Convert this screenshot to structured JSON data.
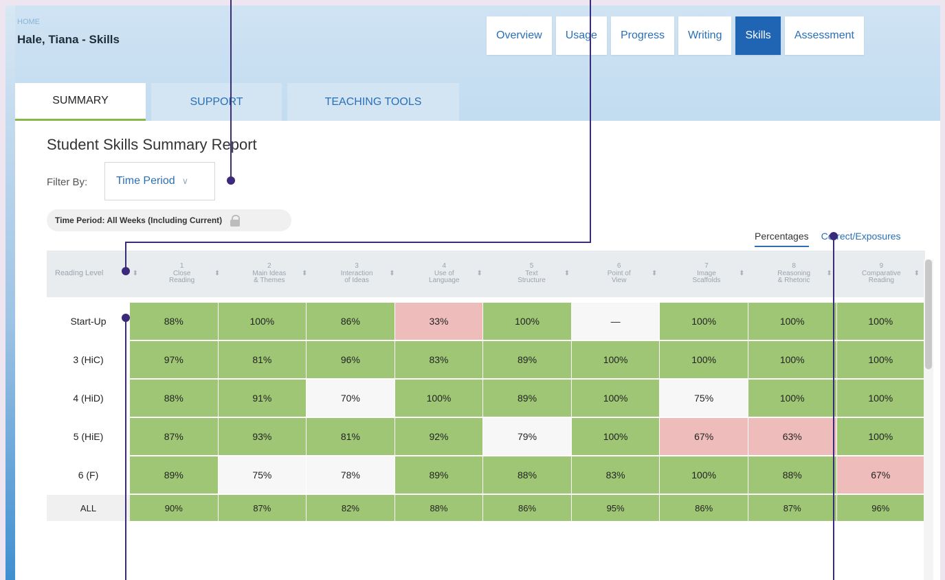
{
  "breadcrumb": "HOME",
  "page_title": "Hale, Tiana - Skills",
  "nav_tabs": [
    "Overview",
    "Usage",
    "Progress",
    "Writing",
    "Skills",
    "Assessment"
  ],
  "sub_tabs": [
    "SUMMARY",
    "SUPPORT",
    "TEACHING TOOLS"
  ],
  "report_title": "Student Skills Summary Report",
  "filter": {
    "label": "Filter By:",
    "value": "Time Period"
  },
  "time_chip": "Time Period: All Weeks (Including Current)",
  "view_toggle": {
    "percentages": "Percentages",
    "correct": "Correct/Exposures"
  },
  "table": {
    "header_first": "Reading Level",
    "columns": [
      {
        "num": "1",
        "line1": "Close",
        "line2": "Reading"
      },
      {
        "num": "2",
        "line1": "Main Ideas",
        "line2": "& Themes"
      },
      {
        "num": "3",
        "line1": "Interaction",
        "line2": "of Ideas"
      },
      {
        "num": "4",
        "line1": "Use of",
        "line2": "Language"
      },
      {
        "num": "5",
        "line1": "Text",
        "line2": "Structure"
      },
      {
        "num": "6",
        "line1": "Point of",
        "line2": "View"
      },
      {
        "num": "7",
        "line1": "Image",
        "line2": "Scaffolds"
      },
      {
        "num": "8",
        "line1": "Reasoning",
        "line2": "& Rhetoric"
      },
      {
        "num": "9",
        "line1": "Comparative",
        "line2": "Reading"
      }
    ],
    "rows": [
      {
        "label": "Start-Up",
        "values": [
          "88%",
          "100%",
          "86%",
          "33%",
          "100%",
          "—",
          "100%",
          "100%",
          "100%"
        ],
        "status": [
          "g",
          "g",
          "g",
          "r",
          "g",
          "w",
          "g",
          "g",
          "g"
        ]
      },
      {
        "label": "3 (HiC)",
        "values": [
          "97%",
          "81%",
          "96%",
          "83%",
          "89%",
          "100%",
          "100%",
          "100%",
          "100%"
        ],
        "status": [
          "g",
          "g",
          "g",
          "g",
          "g",
          "g",
          "g",
          "g",
          "g"
        ]
      },
      {
        "label": "4 (HiD)",
        "values": [
          "88%",
          "91%",
          "70%",
          "100%",
          "89%",
          "100%",
          "75%",
          "100%",
          "100%"
        ],
        "status": [
          "g",
          "g",
          "w",
          "g",
          "g",
          "g",
          "w",
          "g",
          "g"
        ]
      },
      {
        "label": "5 (HiE)",
        "values": [
          "87%",
          "93%",
          "81%",
          "92%",
          "79%",
          "100%",
          "67%",
          "63%",
          "100%"
        ],
        "status": [
          "g",
          "g",
          "g",
          "g",
          "w",
          "g",
          "r",
          "r",
          "g"
        ]
      },
      {
        "label": "6 (F)",
        "values": [
          "89%",
          "75%",
          "78%",
          "89%",
          "88%",
          "83%",
          "100%",
          "88%",
          "67%"
        ],
        "status": [
          "g",
          "w",
          "w",
          "g",
          "g",
          "g",
          "g",
          "g",
          "r"
        ]
      }
    ],
    "all_row": {
      "label": "ALL",
      "values": [
        "90%",
        "87%",
        "82%",
        "88%",
        "86%",
        "95%",
        "86%",
        "87%",
        "96%"
      ]
    }
  },
  "colors": {
    "green": "#9fc675",
    "white": "#f7f7f7",
    "red": "#efbcbc",
    "accent": "#1f65b3",
    "callout": "#3b2a7a"
  }
}
